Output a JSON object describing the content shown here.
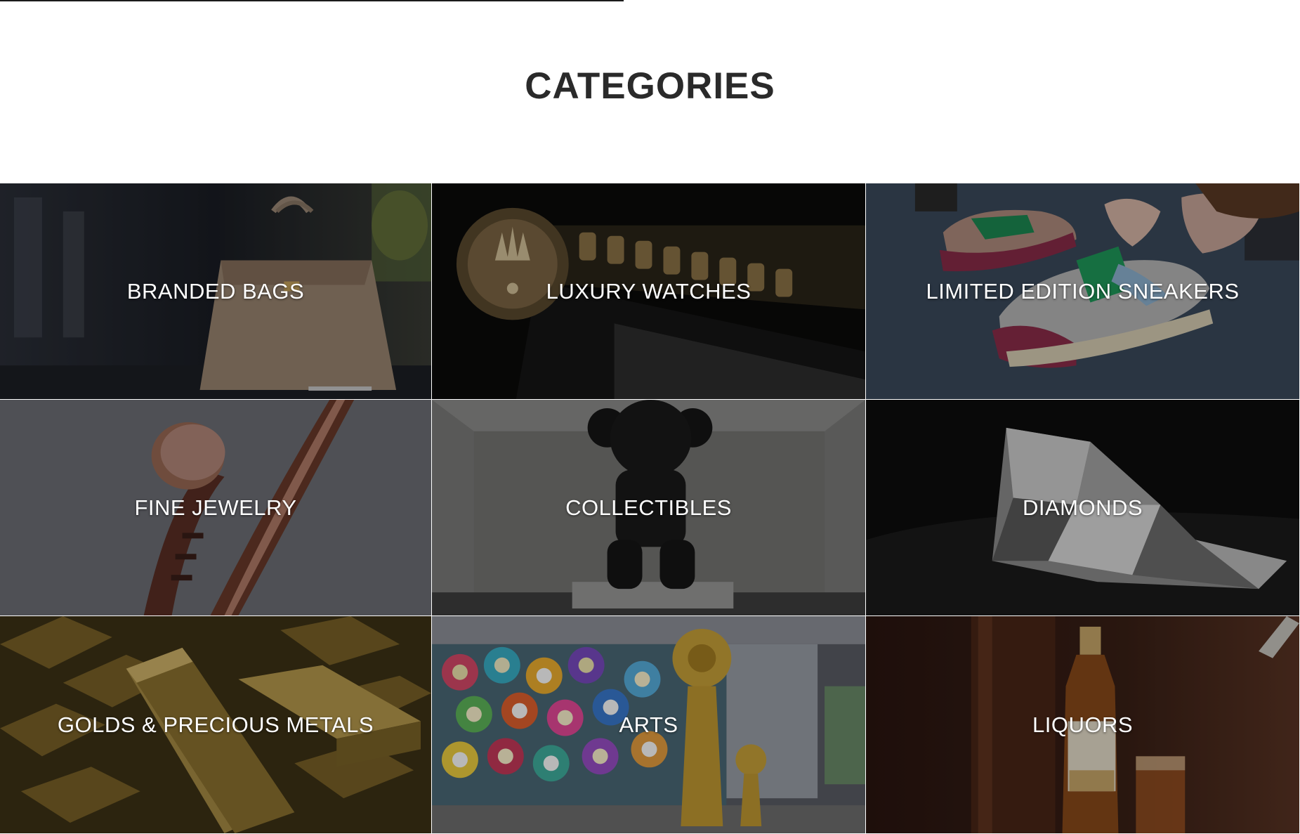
{
  "page": {
    "heading": "CATEGORIES"
  },
  "categories": [
    {
      "label": "BRANDED BAGS",
      "icon": "handbag-image"
    },
    {
      "label": "LUXURY WATCHES",
      "icon": "watch-image"
    },
    {
      "label": "LIMITED EDITION SNEAKERS",
      "icon": "sneakers-image"
    },
    {
      "label": "FINE JEWELRY",
      "icon": "jewelry-image"
    },
    {
      "label": "COLLECTIBLES",
      "icon": "figure-image"
    },
    {
      "label": "DIAMONDS",
      "icon": "diamond-image"
    },
    {
      "label": "GOLDS & PRECIOUS METALS",
      "icon": "gold-bars-image"
    },
    {
      "label": "ARTS",
      "icon": "artwork-image"
    },
    {
      "label": "LIQUORS",
      "icon": "whisky-image"
    }
  ],
  "colors": {
    "heading": "#2a2a2a",
    "label": "#ffffff",
    "background": "#ffffff"
  }
}
